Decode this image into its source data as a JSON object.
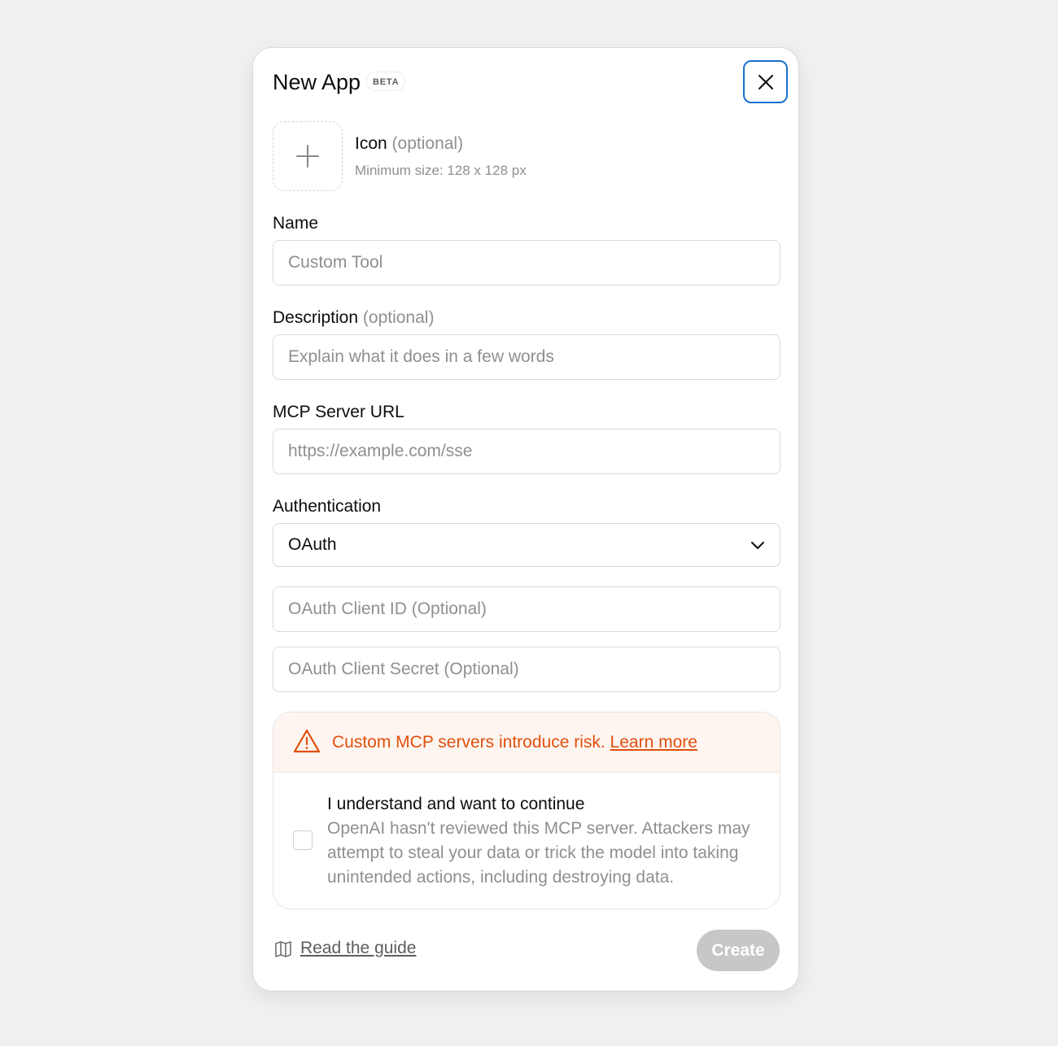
{
  "dialog": {
    "title": "New App",
    "badge": "BETA"
  },
  "icon": {
    "label": "Icon",
    "optional": "(optional)",
    "hint": "Minimum size: 128 x 128 px"
  },
  "name": {
    "label": "Name",
    "placeholder": "Custom Tool"
  },
  "description": {
    "label": "Description",
    "optional": "(optional)",
    "placeholder": "Explain what it does in a few words"
  },
  "server_url": {
    "label": "MCP Server URL",
    "placeholder": "https://example.com/sse"
  },
  "authentication": {
    "label": "Authentication",
    "selected": "OAuth"
  },
  "oauth": {
    "client_id_placeholder": "OAuth Client ID (Optional)",
    "client_secret_placeholder": "OAuth Client Secret (Optional)"
  },
  "warning": {
    "text": "Custom MCP servers introduce risk.",
    "link": "Learn more",
    "color": "#e04f0e"
  },
  "consent": {
    "title": "I understand and want to continue",
    "body": "OpenAI hasn't reviewed this MCP server. Attackers may attempt to steal your data or trick the model into taking unintended actions, including destroying data.",
    "checked": false
  },
  "footer": {
    "guide_link": "Read the guide",
    "create_label": "Create"
  },
  "icons": {
    "close": "close-icon",
    "add": "plus-icon",
    "dropdown": "chevron-down-icon",
    "warning": "warning-triangle-icon",
    "guide": "book-icon"
  }
}
